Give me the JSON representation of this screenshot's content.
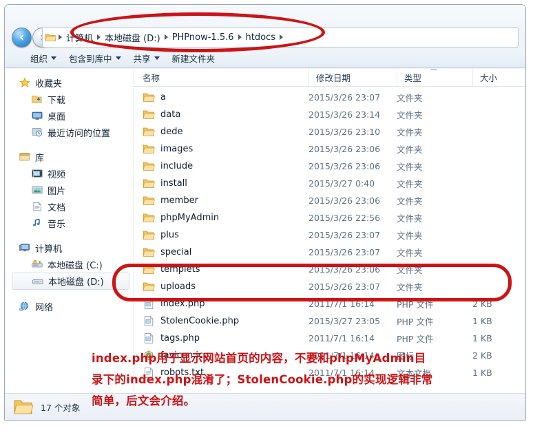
{
  "window": {
    "address_bar": {
      "folder_icon": "folder-icon",
      "crumbs": [
        "计算机",
        "本地磁盘 (D:)",
        "PHPnow-1.5.6",
        "htdocs"
      ]
    },
    "nav": {
      "back_icon": "back-arrow-icon",
      "forward_icon": "forward-arrow-icon",
      "recent_pages_icon": "chevron-down-icon"
    }
  },
  "toolbar": {
    "items": [
      {
        "label": "组织",
        "has_caret": true
      },
      {
        "label": "包含到库中",
        "has_caret": true
      },
      {
        "label": "共享",
        "has_caret": true
      },
      {
        "label": "新建文件夹",
        "has_caret": false
      }
    ]
  },
  "sidebar": {
    "groups": [
      {
        "header": {
          "label": "收藏夹",
          "icon": "star-icon"
        },
        "items": [
          {
            "label": "下载",
            "icon": "downloads-icon"
          },
          {
            "label": "桌面",
            "icon": "desktop-icon"
          },
          {
            "label": "最近访问的位置",
            "icon": "recent-places-icon"
          }
        ]
      },
      {
        "header": {
          "label": "库",
          "icon": "library-icon"
        },
        "items": [
          {
            "label": "视频",
            "icon": "video-icon"
          },
          {
            "label": "图片",
            "icon": "pictures-icon"
          },
          {
            "label": "文档",
            "icon": "documents-icon"
          },
          {
            "label": "音乐",
            "icon": "music-icon"
          }
        ]
      },
      {
        "header": {
          "label": "计算机",
          "icon": "computer-icon"
        },
        "items": [
          {
            "label": "本地磁盘 (C:)",
            "icon": "system-drive-icon",
            "selected": false
          },
          {
            "label": "本地磁盘 (D:)",
            "icon": "drive-icon",
            "selected": true
          }
        ]
      },
      {
        "header": {
          "label": "网络",
          "icon": "network-icon"
        },
        "items": []
      }
    ]
  },
  "file_list": {
    "columns": [
      {
        "key": "name",
        "label": "名称"
      },
      {
        "key": "date",
        "label": "修改日期"
      },
      {
        "key": "type",
        "label": "类型",
        "sorted": true
      },
      {
        "key": "size",
        "label": "大小"
      }
    ],
    "rows": [
      {
        "name": "a",
        "date": "2015/3/26 23:07",
        "type": "文件夹",
        "size": "",
        "icon": "folder-icon"
      },
      {
        "name": "data",
        "date": "2015/3/26 23:14",
        "type": "文件夹",
        "size": "",
        "icon": "folder-icon"
      },
      {
        "name": "dede",
        "date": "2015/3/26 23:10",
        "type": "文件夹",
        "size": "",
        "icon": "folder-icon"
      },
      {
        "name": "images",
        "date": "2015/3/26 23:06",
        "type": "文件夹",
        "size": "",
        "icon": "folder-icon"
      },
      {
        "name": "include",
        "date": "2015/3/26 23:06",
        "type": "文件夹",
        "size": "",
        "icon": "folder-icon"
      },
      {
        "name": "install",
        "date": "2015/3/27 0:40",
        "type": "文件夹",
        "size": "",
        "icon": "folder-icon"
      },
      {
        "name": "member",
        "date": "2015/3/26 23:06",
        "type": "文件夹",
        "size": "",
        "icon": "folder-icon"
      },
      {
        "name": "phpMyAdmin",
        "date": "2015/3/26 22:56",
        "type": "文件夹",
        "size": "",
        "icon": "folder-icon"
      },
      {
        "name": "plus",
        "date": "2015/3/26 23:07",
        "type": "文件夹",
        "size": "",
        "icon": "folder-icon"
      },
      {
        "name": "special",
        "date": "2015/3/26 23:07",
        "type": "文件夹",
        "size": "",
        "icon": "folder-icon"
      },
      {
        "name": "templets",
        "date": "2015/3/26 23:06",
        "type": "文件夹",
        "size": "",
        "icon": "folder-icon"
      },
      {
        "name": "uploads",
        "date": "2015/3/26 23:07",
        "type": "文件夹",
        "size": "",
        "icon": "folder-icon"
      },
      {
        "name": "index.php",
        "date": "2011/7/1 16:14",
        "type": "PHP 文件",
        "size": "2 KB",
        "icon": "php-file-icon"
      },
      {
        "name": "StolenCookie.php",
        "date": "2015/3/27 23:05",
        "type": "PHP 文件",
        "size": "1 KB",
        "icon": "php-file-icon"
      },
      {
        "name": "tags.php",
        "date": "2011/7/1 16:14",
        "type": "PHP 文件",
        "size": "1 KB",
        "icon": "php-file-icon"
      },
      {
        "name": "favicon.ico",
        "date": "2011/7/1 16:14",
        "type": "图标",
        "size": "2 KB",
        "icon": "ico-file-icon"
      },
      {
        "name": "robots.txt",
        "date": "2011/7/1 16:14",
        "type": "文本文档",
        "size": "1 KB",
        "icon": "text-file-icon"
      }
    ]
  },
  "status_bar": {
    "icon": "folder-icon",
    "text": "17 个对象"
  },
  "annotations": {
    "accent_color": "#cc1417",
    "highlight_address_bar": "oval-around-address-bar",
    "highlight_php_files": "oval-around-index-and-stolencookie",
    "caption_lines": [
      "index.php用于显示网站首页的内容，不要和phpMyAdmin目",
      "录下的index.php混淆了；StolenCookie.php的实现逻辑非常",
      "简单，后文会介绍。"
    ]
  }
}
